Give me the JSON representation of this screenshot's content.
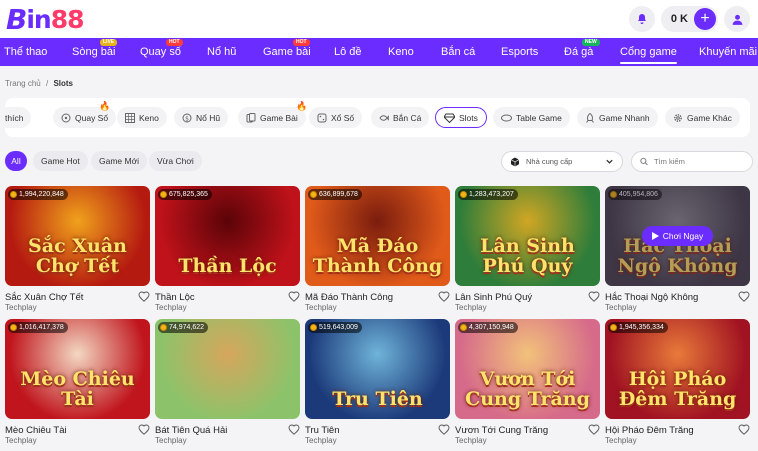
{
  "logo": {
    "text_b": "B",
    "text_in": "in",
    "text_num": "88"
  },
  "header": {
    "balance": "0 K"
  },
  "nav": [
    {
      "label": "Thể thao",
      "badge": ""
    },
    {
      "label": "Sòng bài",
      "badge": "LIVE"
    },
    {
      "label": "Quay số",
      "badge": "HOT"
    },
    {
      "label": "Nổ hũ",
      "badge": ""
    },
    {
      "label": "Game bài",
      "badge": "HOT"
    },
    {
      "label": "Lô đề",
      "badge": ""
    },
    {
      "label": "Keno",
      "badge": ""
    },
    {
      "label": "Bắn cá",
      "badge": ""
    },
    {
      "label": "Esports",
      "badge": ""
    },
    {
      "label": "Đá gà",
      "badge": "NEW"
    },
    {
      "label": "Cổng game",
      "badge": "",
      "active": true
    },
    {
      "label": "Khuyến mãi",
      "badge": ""
    }
  ],
  "breadcrumb": {
    "home": "Trang chủ",
    "sep": "/",
    "current": "Slots"
  },
  "categories": [
    {
      "label": "thích",
      "icon": "heart-icon"
    },
    {
      "label": "Quay Số",
      "icon": "lottery-icon"
    },
    {
      "label": "Keno",
      "icon": "keno-grid-icon"
    },
    {
      "label": "Nổ Hũ",
      "icon": "jar-icon"
    },
    {
      "label": "Game Bài",
      "icon": "cards-icon"
    },
    {
      "label": "Xổ Số",
      "icon": "dice-icon"
    },
    {
      "label": "Bắn Cá",
      "icon": "fish-icon"
    },
    {
      "label": "Slots",
      "icon": "diamond-icon",
      "active": true
    },
    {
      "label": "Table Game",
      "icon": "table-icon"
    },
    {
      "label": "Game Nhanh",
      "icon": "rocket-icon"
    },
    {
      "label": "Game Khác",
      "icon": "gear-icon"
    }
  ],
  "filters": [
    "All",
    "Game Hot",
    "Game Mới",
    "Vừa Chơi"
  ],
  "provider_select": {
    "value": "Nhà cung cấp"
  },
  "search": {
    "placeholder": "Tìm kiếm"
  },
  "games": [
    {
      "name": "Sắc Xuân Chợ Tết",
      "provider": "Techplay",
      "jackpot": "1,994,220,848",
      "art_title": "Sắc Xuân Chợ Tết",
      "bg": "#b51a10",
      "bg2": "#f0a21c"
    },
    {
      "name": "Thần Lộc",
      "provider": "Techplay",
      "jackpot": "675,825,365",
      "art_title": "Thần Lộc",
      "bg": "#c0121a",
      "bg2": "#5a0408"
    },
    {
      "name": "Mã Đáo Thành Công",
      "provider": "Techplay",
      "jackpot": "636,899,678",
      "art_title": "Mã Đáo Thành Công",
      "bg": "#e05a1a",
      "bg2": "#7a1c0e"
    },
    {
      "name": "Lân Sinh Phú Quý",
      "provider": "Techplay",
      "jackpot": "1,283,473,207",
      "art_title": "Lân Sinh Phú Quý",
      "bg": "#2e7d3a",
      "bg2": "#d1a623"
    },
    {
      "name": "Hắc Thoại Ngộ Không",
      "provider": "Techplay",
      "jackpot": "405,954,806",
      "art_title": "Hắc Thoại Ngộ Không",
      "bg": "#4a4450",
      "bg2": "#8d8b91",
      "hover": true
    },
    {
      "name": "Mèo Chiêu Tài",
      "provider": "Techplay",
      "jackpot": "1,016,417,378",
      "art_title": "Mèo Chiêu Tài",
      "bg": "#c0151d",
      "bg2": "#f3d8c2"
    },
    {
      "name": "Bát Tiên Quá Hải",
      "provider": "Techplay",
      "jackpot": "74,974,622",
      "art_title": "",
      "bg": "#8cc36a",
      "bg2": "#d6a65c"
    },
    {
      "name": "Tru Tiên",
      "provider": "Techplay",
      "jackpot": "519,643,009",
      "art_title": "Tru Tiên",
      "bg": "#1c3a7a",
      "bg2": "#6fb4d9"
    },
    {
      "name": "Vươn Tới Cung Trăng",
      "provider": "Techplay",
      "jackpot": "4,307,150,948",
      "art_title": "Vươn Tới Cung Trăng",
      "bg": "#d66a8a",
      "bg2": "#f2c27a"
    },
    {
      "name": "Hội Pháo Đêm Trăng",
      "provider": "Techplay",
      "jackpot": "1,945,356,334",
      "art_title": "Hội Pháo Đêm Trăng",
      "bg": "#a11322",
      "bg2": "#e87a3a"
    }
  ],
  "hover_button": {
    "label": "Chơi Ngay"
  },
  "colors": {
    "accent": "#6a2cff",
    "logo_red": "#ff3b6b"
  }
}
